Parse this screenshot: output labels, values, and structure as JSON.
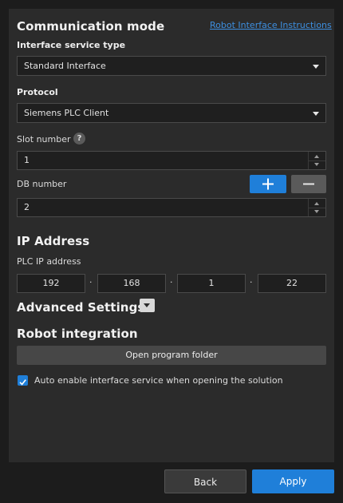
{
  "communication": {
    "title": "Communication mode",
    "instructions_link": "Robot Interface Instructions"
  },
  "interface_service": {
    "label": "Interface service type",
    "selected": "Standard Interface"
  },
  "protocol": {
    "label": "Protocol",
    "selected": "Siemens PLC Client"
  },
  "slot": {
    "label": "Slot number",
    "help_glyph": "?",
    "value": "1"
  },
  "db": {
    "label": "DB number",
    "value": "2"
  },
  "ip": {
    "title": "IP Address",
    "label": "PLC IP address",
    "octets": [
      "192",
      "168",
      "1",
      "22"
    ],
    "separator": "·"
  },
  "advanced": {
    "title": "Advanced Settings"
  },
  "robot_integration": {
    "title": "Robot integration",
    "open_folder_label": "Open program folder",
    "auto_enable_label": "Auto enable interface service when opening the solution",
    "auto_enable_checked": true
  },
  "footer": {
    "back_label": "Back",
    "apply_label": "Apply"
  },
  "colors": {
    "accent": "#1f7fd9",
    "link": "#3d8fe0",
    "panel": "#2b2b2b",
    "background": "#1c1c1c"
  },
  "icons": {
    "add": "plus-icon",
    "remove": "minus-icon",
    "dropdown": "chevron-down-icon",
    "check": "check-icon",
    "help": "help-icon"
  }
}
